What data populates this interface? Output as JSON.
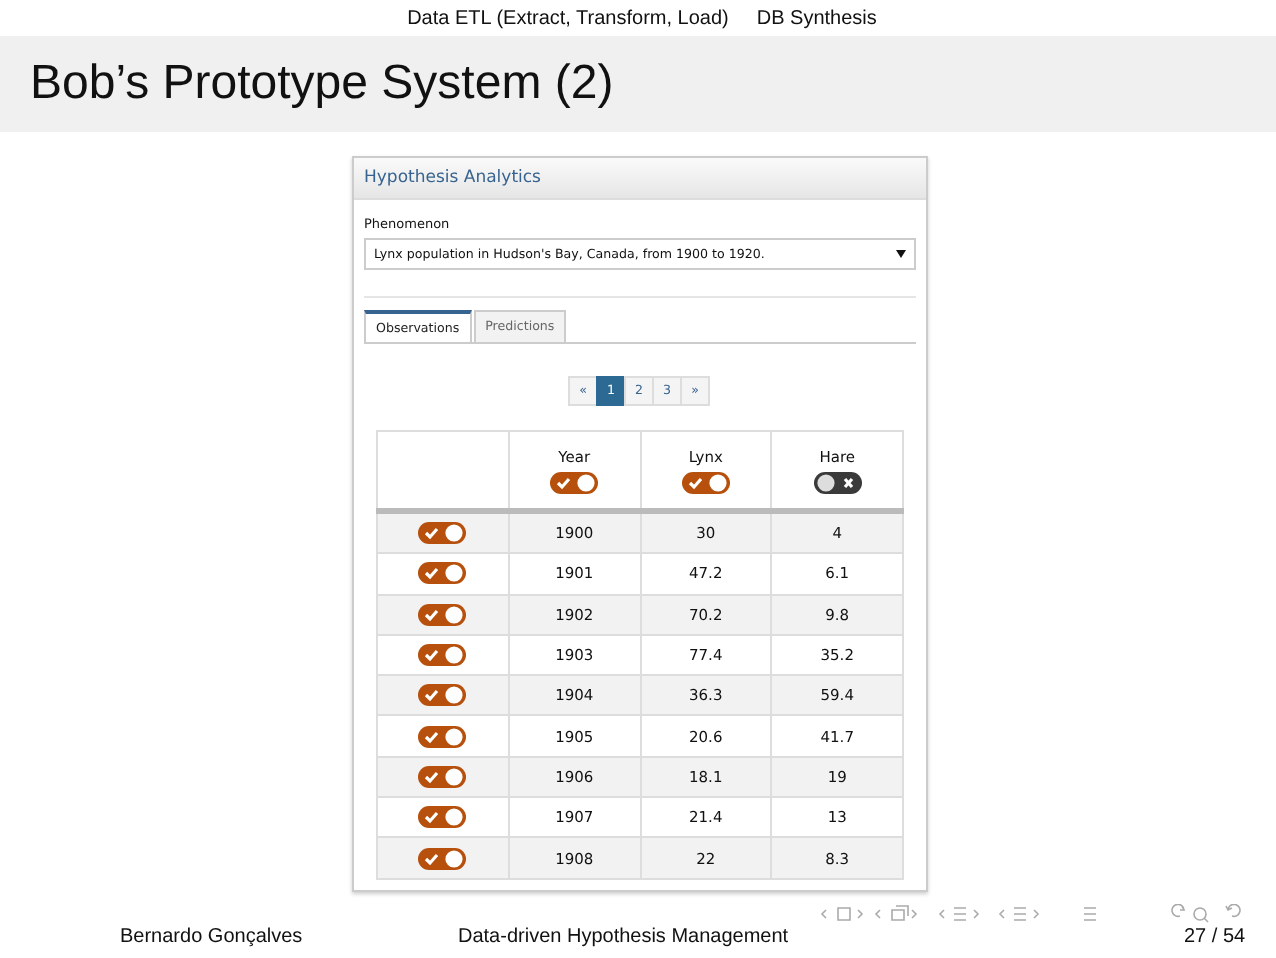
{
  "nav": {
    "sections": [
      "Data ETL (Extract, Transform, Load)",
      "DB Synthesis"
    ]
  },
  "slide_title": "Bob’s Prototype System (2)",
  "app": {
    "title": "Hypothesis Analytics",
    "field_label": "Phenomenon",
    "select_value": "Lynx population in Hudson's Bay, Canada, from 1900 to 1920.",
    "tabs": [
      {
        "label": "Observations",
        "selected": true
      },
      {
        "label": "Predictions",
        "selected": false
      }
    ],
    "pagination": [
      {
        "label": "«",
        "selected": false
      },
      {
        "label": "1",
        "selected": true
      },
      {
        "label": "2",
        "selected": false
      },
      {
        "label": "3",
        "selected": false
      },
      {
        "label": "»",
        "selected": false
      }
    ],
    "table": {
      "columns": [
        {
          "label": "Year",
          "on": true
        },
        {
          "label": "Lynx",
          "on": true
        },
        {
          "label": "Hare",
          "on": false
        }
      ],
      "rows": [
        {
          "on": true,
          "cells": [
            "1900",
            "30",
            "4"
          ]
        },
        {
          "on": true,
          "cells": [
            "1901",
            "47.2",
            "6.1"
          ]
        },
        {
          "on": true,
          "cells": [
            "1902",
            "70.2",
            "9.8"
          ]
        },
        {
          "on": true,
          "cells": [
            "1903",
            "77.4",
            "35.2"
          ]
        },
        {
          "on": true,
          "cells": [
            "1904",
            "36.3",
            "59.4"
          ]
        },
        {
          "on": true,
          "cells": [
            "1905",
            "20.6",
            "41.7"
          ]
        },
        {
          "on": true,
          "cells": [
            "1906",
            "18.1",
            "19"
          ]
        },
        {
          "on": true,
          "cells": [
            "1907",
            "21.4",
            "13"
          ]
        },
        {
          "on": true,
          "cells": [
            "1908",
            "22",
            "8.3"
          ]
        }
      ]
    }
  },
  "footer": {
    "author": "Bernardo Gonçalves",
    "talk_title": "Data-driven Hypothesis Management",
    "page": "27 / 54"
  }
}
